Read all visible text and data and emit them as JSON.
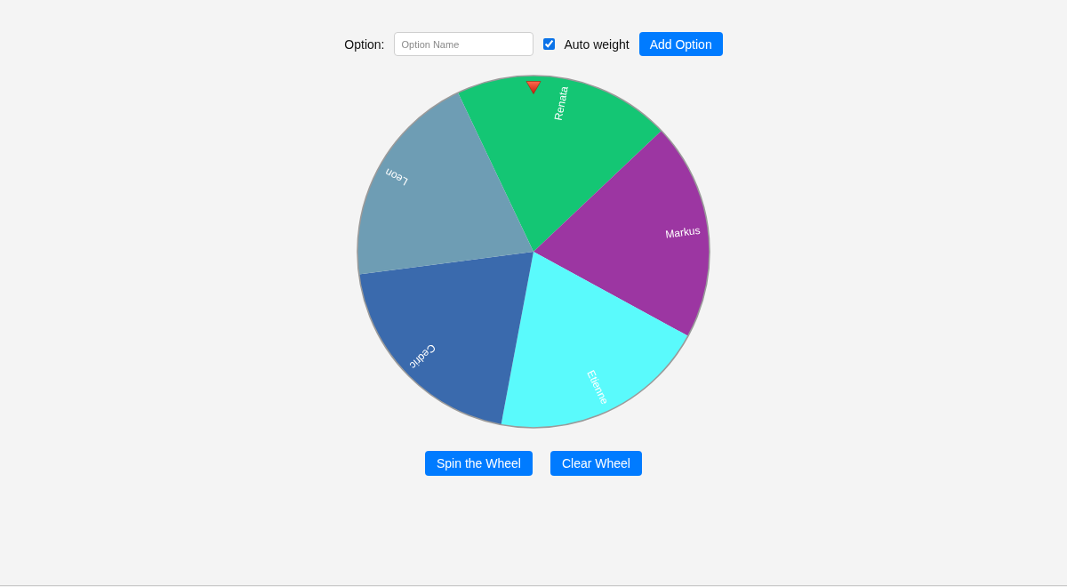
{
  "option_form": {
    "label": "Option:",
    "input": {
      "placeholder": "Option Name"
    },
    "auto_weight": {
      "label": "Auto weight",
      "checked": true
    },
    "add_button": "Add Option"
  },
  "wheel": {
    "options": [
      {
        "label": "Renata",
        "color": "#14c674"
      },
      {
        "label": "Markus",
        "color": "#9c36a2"
      },
      {
        "label": "Etienne",
        "color": "#5afafc"
      },
      {
        "label": "Cedric",
        "color": "#3a6aad"
      },
      {
        "label": "Leon",
        "color": "#6e9db4"
      }
    ]
  },
  "buttons": [
    "Spin the Wheel",
    "Clear Wheel"
  ]
}
